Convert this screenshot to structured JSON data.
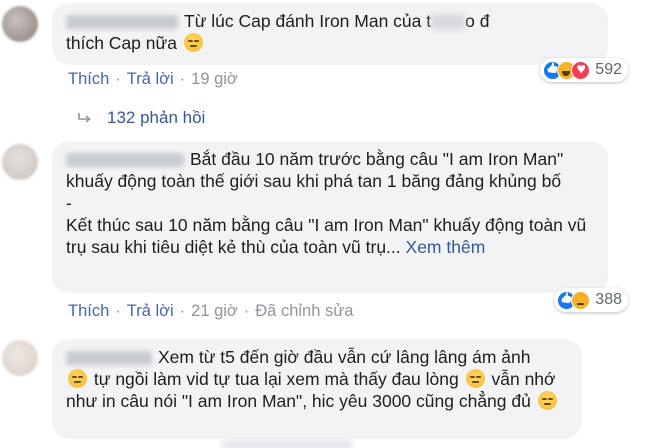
{
  "comments": [
    {
      "text_before": "Từ lúc Cap đánh Iron Man của t",
      "text_after": "o đ",
      "text_line2": "thích Cap nữa",
      "actions": {
        "like": "Thích",
        "reply": "Trả lời",
        "time": "19 giờ"
      },
      "reaction_count": "592",
      "reactions": [
        "like",
        "haha",
        "love"
      ]
    },
    {
      "text": "Bắt đầu 10 năm trước bằng câu \"I am Iron Man\" khuấy động toàn thế giới sau khi phá tan 1 băng đảng khủng bố\n-\nKết thúc sau 10 năm bằng câu \"I am Iron Man\" khuấy động toàn vũ trụ sau khi tiêu diệt kẻ thù của toàn vũ trụ...",
      "see_more": "Xem thêm",
      "actions": {
        "like": "Thích",
        "reply": "Trả lời",
        "time": "21 giờ",
        "edited": "Đã chỉnh sửa"
      },
      "reaction_count": "388",
      "reactions": [
        "like",
        "sad"
      ]
    },
    {
      "text_1": "Xem từ t5 đến giờ đầu vẫn cứ lâng lâng ám ảnh",
      "text_2": "tự ngồi làm vid tự tua lại xem mà thấy đau lòng",
      "text_3": "vẫn nhớ như in câu nói \"I am Iron Man\", hic yêu 3000 cũng chẳng đủ"
    }
  ],
  "replies_link": "132 phản hồi",
  "icons": {
    "reply": "reply-arrow-icon",
    "emoji": "pensive-face-emoji"
  },
  "colors": {
    "link": "#385898",
    "meta": "#90949c",
    "bubble": "#f2f3f5",
    "like": "#1877f2",
    "love": "#f33e58",
    "haha": "#f7b125"
  }
}
